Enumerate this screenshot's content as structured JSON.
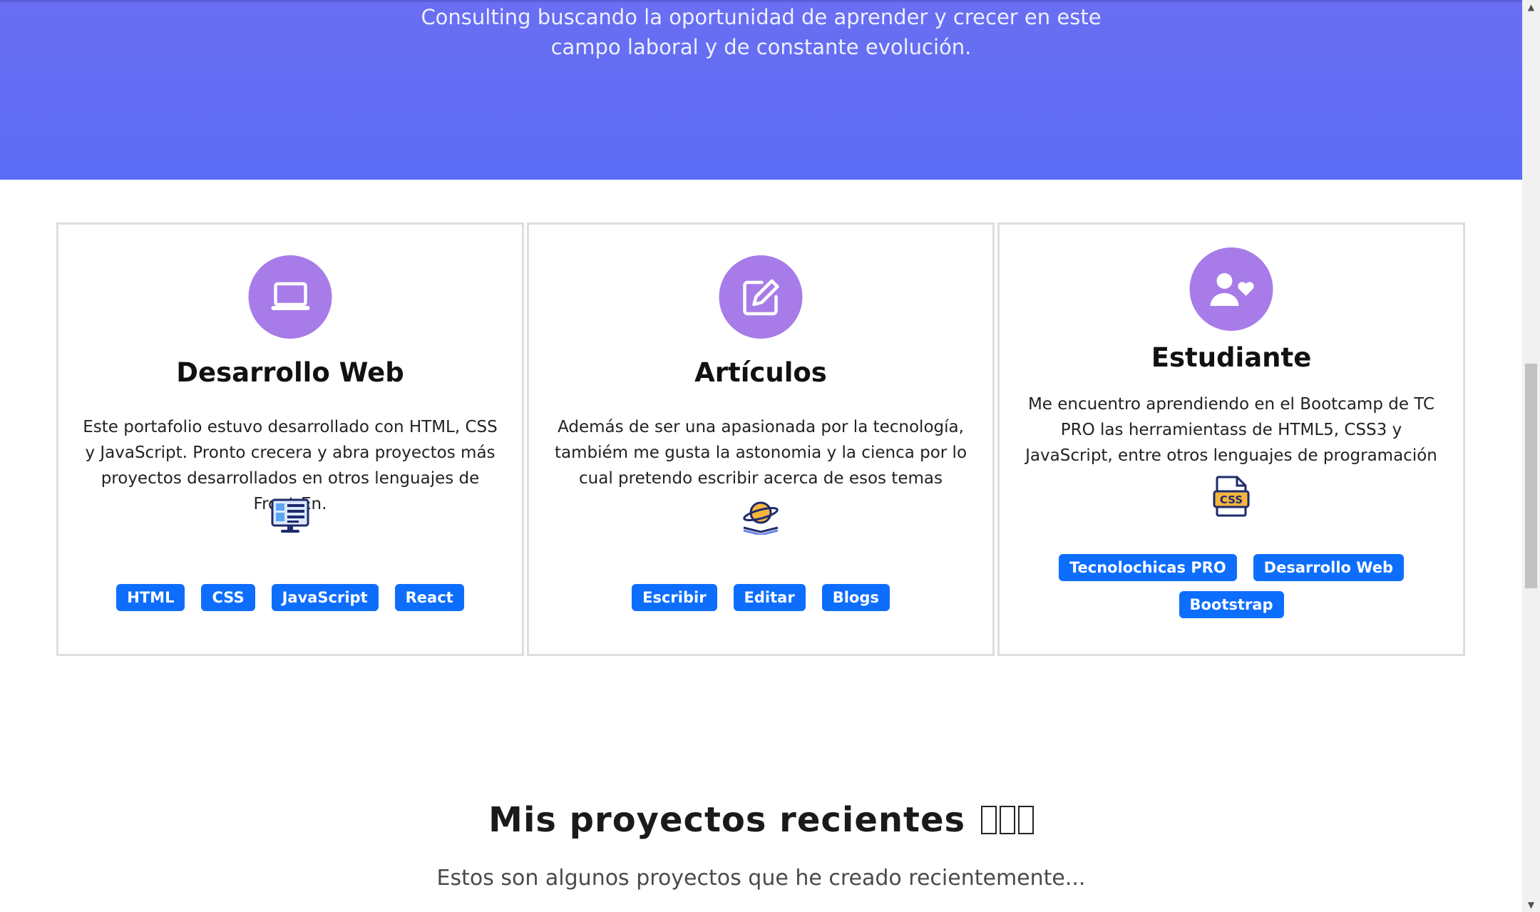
{
  "hero": {
    "line1": "Consulting buscando la oportunidad de aprender y crecer en este",
    "line2": "campo laboral y de constante evolución."
  },
  "cards": [
    {
      "icon": "laptop-icon",
      "title": "Desarrollo Web",
      "text": "Este portafolio estuvo desarrollado con HTML, CSS y JavaScript. Pronto crecera y abra proyectos más proyectos desarrollados en otros lenguajes de Front-En.",
      "mini_icon": "web-page-monitor-icon",
      "badges": [
        "HTML",
        "CSS",
        "JavaScript",
        "React"
      ]
    },
    {
      "icon": "edit-note-icon",
      "title": "Artículos",
      "text": "Además de ser una apasionada por la tecnología, tambiém me gusta la astonomia y la cienca por lo cual pretendo escribir acerca de esos temas",
      "mini_icon": "planet-book-icon",
      "badges": [
        "Escribir",
        "Editar",
        "Blogs"
      ]
    },
    {
      "icon": "user-heart-icon",
      "title": "Estudiante",
      "text": "Me encuentro aprendiendo en el Bootcamp de TC PRO las herramientass de HTML5, CSS3 y JavaScript, entre otros lenguajes de programación",
      "mini_icon": "css-file-icon",
      "badges": [
        "Tecnolochicas PRO",
        "Desarrollo Web",
        "Bootstrap"
      ]
    }
  ],
  "projects": {
    "title": "Mis proyectos recientes",
    "subtitle": "Estos son algunos proyectos que he creado recientemente..."
  },
  "colors": {
    "hero": "#5b6cf4",
    "circle": "#a77be8",
    "badge": "#0d6efd"
  }
}
